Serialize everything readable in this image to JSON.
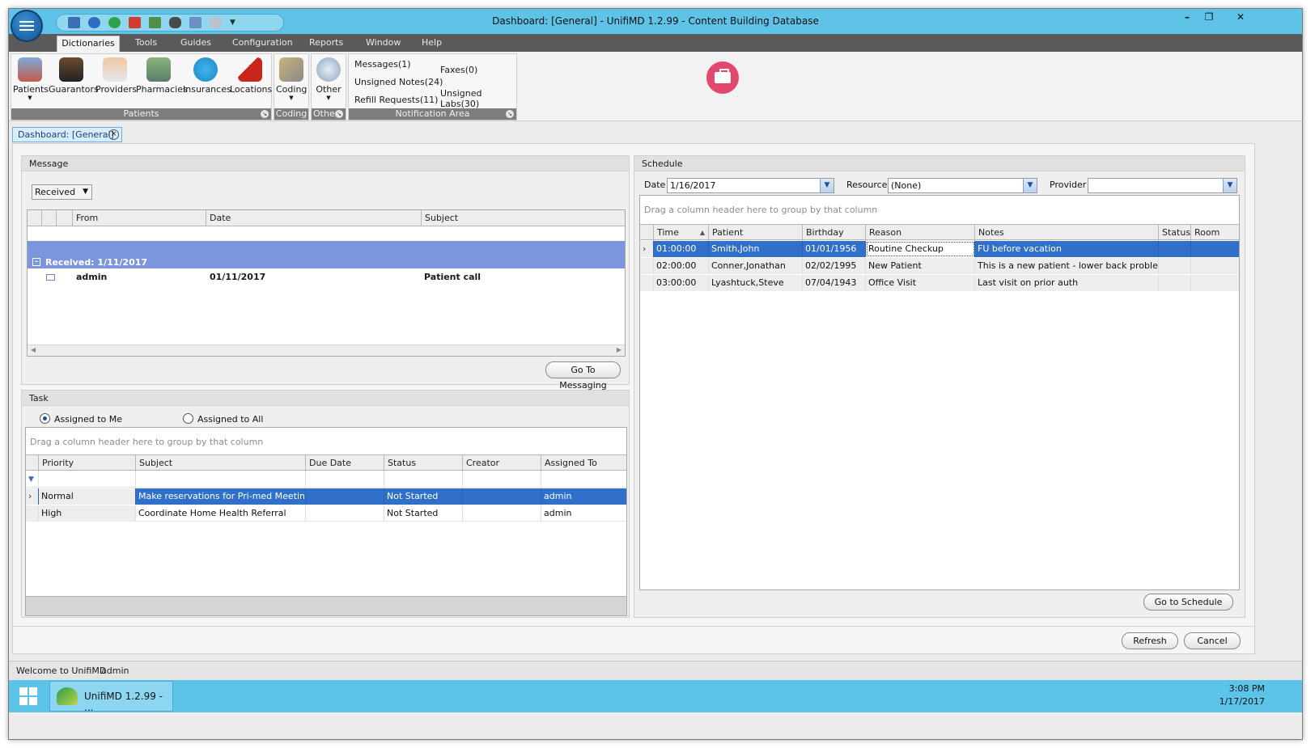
{
  "window": {
    "title": "Dashboard: [General] - UnifiMD 1.2.99 - Content Building Database",
    "min_label": "–",
    "max_label": "❐",
    "close_label": "✕"
  },
  "menu": {
    "items": [
      "Dictionaries",
      "Tools",
      "Guides",
      "Configuration",
      "Reports",
      "Window",
      "Help"
    ]
  },
  "ribbon": {
    "patients_group": {
      "title": "Patients",
      "buttons": [
        "Patients",
        "Guarantors",
        "Providers",
        "Pharmacies",
        "Insurances",
        "Locations"
      ]
    },
    "coding_group": {
      "title": "Coding",
      "button": "Coding"
    },
    "other_group": {
      "title": "Other",
      "button": "Other"
    },
    "notification_group": {
      "title": "Notification Area",
      "messages": "Messages(1)",
      "unsigned_notes": "Unsigned Notes(24)",
      "refill_requests": "Refill Requests(11)",
      "faxes": "Faxes(0)",
      "unsigned_labs": "Unsigned Labs(30)"
    }
  },
  "doc_tab": {
    "label": "Dashboard: [General]",
    "close": "×"
  },
  "message": {
    "title": "Message",
    "filter_value": "Received",
    "columns": [
      "From",
      "Date",
      "Subject"
    ],
    "group_label": "Received: 1/11/2017",
    "rows": [
      {
        "from": "admin",
        "date": "01/11/2017",
        "subject": "Patient call"
      }
    ],
    "goto_button": "Go To Messaging"
  },
  "task": {
    "title": "Task",
    "radio_me": "Assigned to Me",
    "radio_all": "Assigned to All",
    "group_hint": "Drag a column header here to group by that column",
    "columns": [
      "Priority",
      "Subject",
      "Due Date",
      "Status",
      "Creator",
      "Assigned To"
    ],
    "rows": [
      {
        "priority": "Normal",
        "subject": "Make reservations for Pri-med Meeting",
        "due": "",
        "status": "Not Started",
        "creator": "",
        "assigned": "admin"
      },
      {
        "priority": "High",
        "subject": "Coordinate Home Health Referral",
        "due": "",
        "status": "Not Started",
        "creator": "",
        "assigned": "admin"
      }
    ]
  },
  "schedule": {
    "title": "Schedule",
    "date_label": "Date",
    "date_value": "1/16/2017",
    "resource_label": "Resource",
    "resource_value": "(None)",
    "provider_label": "Provider",
    "provider_value": "",
    "group_hint": "Drag a column header here to group by that column",
    "columns": [
      "Time",
      "Patient",
      "Birthday",
      "Reason",
      "Notes",
      "Status",
      "Room"
    ],
    "rows": [
      {
        "time": "01:00:00",
        "patient": "Smith,John",
        "birthday": "01/01/1956",
        "reason": "Routine Checkup",
        "notes": "FU before vacation",
        "status": "",
        "room": ""
      },
      {
        "time": "02:00:00",
        "patient": "Conner,Jonathan",
        "birthday": "02/02/1995",
        "reason": "New Patient",
        "notes": "This is a new patient - lower back problem fr...",
        "status": "",
        "room": ""
      },
      {
        "time": "03:00:00",
        "patient": "Lyashtuck,Steve",
        "birthday": "07/04/1943",
        "reason": "Office Visit",
        "notes": "Last visit on prior auth",
        "status": "",
        "room": ""
      }
    ],
    "goto_button": "Go to Schedule"
  },
  "footer": {
    "refresh": "Refresh",
    "cancel": "Cancel"
  },
  "status": {
    "welcome": "Welcome to UnifiMD",
    "user": "admin"
  },
  "taskbar": {
    "app_label": "UnifiMD 1.2.99 - ...",
    "time": "3:08 PM",
    "date": "1/17/2017"
  },
  "colors": {
    "accent": "#5fc3e8",
    "selection": "#3070c8",
    "group_row": "#7b96dc",
    "brand_logo": "#e2476e"
  }
}
